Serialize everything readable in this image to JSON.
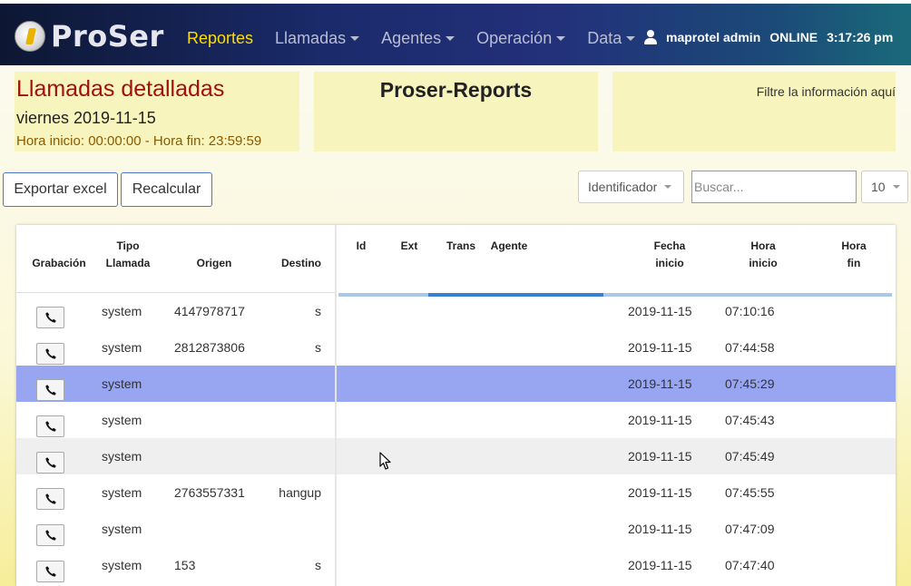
{
  "navbar": {
    "brand": "ProSer",
    "items": [
      {
        "label": "Reportes",
        "active": true,
        "dropdown": false
      },
      {
        "label": "Llamadas",
        "active": false,
        "dropdown": true
      },
      {
        "label": "Agentes",
        "active": false,
        "dropdown": true
      },
      {
        "label": "Operación",
        "active": false,
        "dropdown": true
      },
      {
        "label": "Data",
        "active": false,
        "dropdown": true
      }
    ],
    "user": "maprotel admin",
    "status": "ONLINE",
    "time": "3:17:26 pm"
  },
  "report": {
    "title": "Llamadas detalladas",
    "date": "viernes 2019-11-15",
    "hours": "Hora inicio: 00:00:00 - Hora fin: 23:59:59",
    "app_title": "Proser-Reports",
    "filter_hint": "Filtre la información aquí"
  },
  "toolbar": {
    "export_label": "Exportar excel",
    "recalc_label": "Recalcular",
    "identifier_select": "Identificador",
    "search_placeholder": "Buscar...",
    "page_size": "10"
  },
  "table": {
    "headers": {
      "grabacion": "Grabación",
      "tipo_1": "Tipo",
      "tipo_2": "Llamada",
      "origen": "Origen",
      "destino": "Destino",
      "id": "Id",
      "ext": "Ext",
      "trans": "Trans",
      "agente": "Agente",
      "fecha_1": "Fecha",
      "fecha_2": "inicio",
      "hora_inicio_1": "Hora",
      "hora_inicio_2": "inicio",
      "hora_fin_1": "Hora",
      "hora_fin_2": "fin"
    },
    "rows": [
      {
        "tipo": "system",
        "origen": "4147978717",
        "destino": "s",
        "fecha": "2019-11-15",
        "hora": "07:10:16"
      },
      {
        "tipo": "system",
        "origen": "2812873806",
        "destino": "s",
        "fecha": "2019-11-15",
        "hora": "07:44:58"
      },
      {
        "tipo": "system",
        "origen": "",
        "destino": "",
        "fecha": "2019-11-15",
        "hora": "07:45:29"
      },
      {
        "tipo": "system",
        "origen": "",
        "destino": "",
        "fecha": "2019-11-15",
        "hora": "07:45:43"
      },
      {
        "tipo": "system",
        "origen": "",
        "destino": "",
        "fecha": "2019-11-15",
        "hora": "07:45:49"
      },
      {
        "tipo": "system",
        "origen": "2763557331",
        "destino": "hangup",
        "fecha": "2019-11-15",
        "hora": "07:45:55"
      },
      {
        "tipo": "system",
        "origen": "",
        "destino": "",
        "fecha": "2019-11-15",
        "hora": "07:47:09"
      },
      {
        "tipo": "system",
        "origen": "153",
        "destino": "s",
        "fecha": "2019-11-15",
        "hora": "07:47:40"
      }
    ],
    "selected_row": 2,
    "hovered_row": 4
  },
  "icons": {
    "logo": "proser-logo-icon",
    "user": "user-icon",
    "phone": "phone-icon",
    "cursor": "mouse-cursor-icon"
  },
  "colors": {
    "nav_active": "#ffdd00",
    "report_title": "#a11010",
    "selected_row": "#98a6f2",
    "progress": "#3a80d2"
  }
}
